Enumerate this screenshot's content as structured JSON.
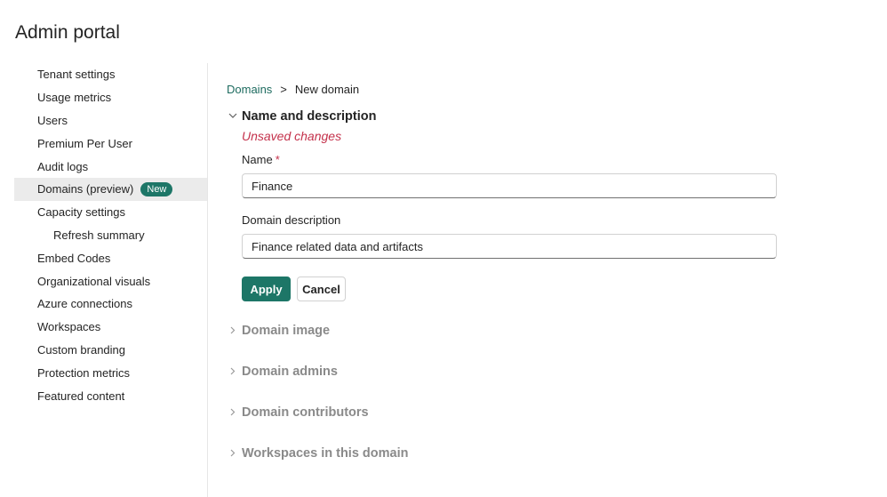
{
  "page": {
    "title": "Admin portal"
  },
  "sidebar": {
    "items": [
      {
        "label": "Tenant settings"
      },
      {
        "label": "Usage metrics"
      },
      {
        "label": "Users"
      },
      {
        "label": "Premium Per User"
      },
      {
        "label": "Audit logs"
      },
      {
        "label": "Domains (preview)",
        "badge": "New",
        "active": true
      },
      {
        "label": "Capacity settings"
      },
      {
        "label": "Refresh summary",
        "sub": true
      },
      {
        "label": "Embed Codes"
      },
      {
        "label": "Organizational visuals"
      },
      {
        "label": "Azure connections"
      },
      {
        "label": "Workspaces"
      },
      {
        "label": "Custom branding"
      },
      {
        "label": "Protection metrics"
      },
      {
        "label": "Featured content"
      }
    ]
  },
  "breadcrumb": {
    "parent": "Domains",
    "separator": ">",
    "current": "New domain"
  },
  "name_section": {
    "title": "Name and description",
    "unsaved": "Unsaved changes",
    "name_label": "Name",
    "required_mark": "*",
    "name_value": "Finance",
    "description_label": "Domain description",
    "description_value": "Finance related data and artifacts",
    "apply_label": "Apply",
    "cancel_label": "Cancel"
  },
  "collapsed_sections": [
    {
      "title": "Domain image"
    },
    {
      "title": "Domain admins"
    },
    {
      "title": "Domain contributors"
    },
    {
      "title": "Workspaces in this domain"
    }
  ],
  "colors": {
    "accent": "#1d7667",
    "link": "#1d6b5f",
    "error": "#c4314b",
    "active_nav_bg": "#ebebeb",
    "collapsed_text": "#8a8a8a"
  },
  "icons": {
    "expanded": "chevron-down-icon",
    "collapsed": "chevron-right-icon"
  }
}
